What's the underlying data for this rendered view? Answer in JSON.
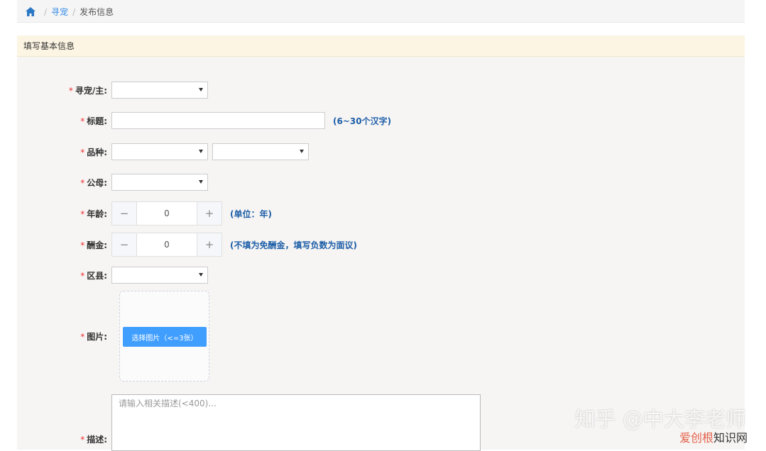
{
  "breadcrumb": {
    "link": "寻宠",
    "current": "发布信息",
    "separator": "/"
  },
  "panel": {
    "title": "填写基本信息"
  },
  "form": {
    "required_mark": "*",
    "owner": {
      "label": "寻宠/主:"
    },
    "title": {
      "label": "标题:",
      "hint": "(6~30个汉字)"
    },
    "breed": {
      "label": "品种:"
    },
    "gender": {
      "label": "公母:"
    },
    "age": {
      "label": "年龄:",
      "value": "0",
      "minus": "−",
      "plus": "+",
      "hint": "(单位：年)"
    },
    "reward": {
      "label": "酬金:",
      "value": "0",
      "minus": "−",
      "plus": "+",
      "hint": "(不填为免酬金，填写负数为面议)"
    },
    "district": {
      "label": "区县:"
    },
    "image": {
      "label": "图片:",
      "button": "选择图片（<=3张）"
    },
    "description": {
      "label": "描述:",
      "placeholder": "请输入相关描述(<400)..."
    }
  },
  "watermark": {
    "line1": "知乎 @中大李老师",
    "line2a": "爱创根",
    "line2b": "知识网"
  },
  "colors": {
    "link": "#3a8ee6",
    "hint": "#1e5fa8",
    "required": "#e33333",
    "upload_button": "#409eff",
    "panel_header": "#fcf5e3"
  }
}
